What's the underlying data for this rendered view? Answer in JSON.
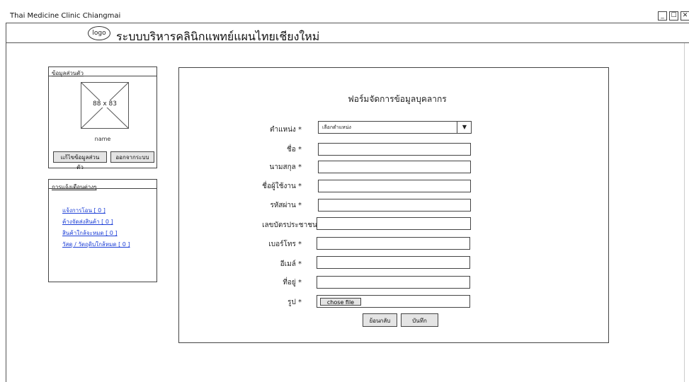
{
  "window": {
    "title": "Thai Medicine Clinic Chiangmai",
    "minimize": "_",
    "maximize": "☐",
    "close": "✕"
  },
  "header": {
    "logo": "logo",
    "app_title": "ระบบบริหารคลินิกแพทย์แผนไทยเชียงใหม่"
  },
  "profile": {
    "title": "ข้อมูลส่วนตัว",
    "photo_placeholder": "88 x 83",
    "name": "name",
    "edit_label": "แก้ไขข้อมูลส่วนตัว",
    "logout_label": "ออกจากระบบ"
  },
  "notifications": {
    "title": "การแจ้งเตือนต่างๆ",
    "items": [
      "แจ้งการโอน [ 0 ]",
      "ค้างจัดส่งสินค้า [ 0 ]",
      "สินค้าใกล้จะหมด [ 0 ]",
      "วัสดุ / วัตถุดิบใกล้หมด [ 0 ]"
    ]
  },
  "form": {
    "title": "ฟอร์มจัดการข้อมูลบุคลากร",
    "position_label": "ตำแหน่ง *",
    "position_selected": "เลือกตำแหน่ง",
    "first_name_label": "ชื่อ *",
    "last_name_label": "นามสกุล *",
    "username_label": "ชื่อผู้ใช้งาน *",
    "password_label": "รหัสผ่าน *",
    "id_card_label": "เลขบัตรประชาชน *",
    "phone_label": "เบอร์โทร *",
    "email_label": "อีเมล์ *",
    "address_label": "ที่อยู่  *",
    "photo_label": "รูป  *",
    "choose_file": "chose file",
    "back_label": "ย้อนกลับ",
    "save_label": "บันทึก"
  }
}
